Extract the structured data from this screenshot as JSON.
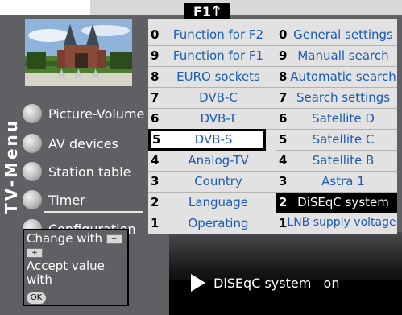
{
  "header": {
    "key_label": "F1",
    "arrow_icon": "up-arrow"
  },
  "rating_stars": "★★★",
  "sidebar": {
    "title": "TV-Menu",
    "items": [
      {
        "label": "Picture-Volume"
      },
      {
        "label": "AV devices"
      },
      {
        "label": "Station table"
      },
      {
        "label": "Timer"
      },
      {
        "label": "Configuration"
      }
    ]
  },
  "middle_menu": [
    {
      "num": "0",
      "label": "Function for F2"
    },
    {
      "num": "9",
      "label": "Function for F1"
    },
    {
      "num": "8",
      "label": "EURO sockets"
    },
    {
      "num": "7",
      "label": "DVB-C"
    },
    {
      "num": "6",
      "label": "DVB-T"
    },
    {
      "num": "5",
      "label": "DVB-S"
    },
    {
      "num": "4",
      "label": "Analog-TV"
    },
    {
      "num": "3",
      "label": "Country"
    },
    {
      "num": "2",
      "label": "Language"
    },
    {
      "num": "1",
      "label": "Operating"
    }
  ],
  "right_menu": [
    {
      "num": "0",
      "label": "General settings"
    },
    {
      "num": "9",
      "label": "Manuall search"
    },
    {
      "num": "8",
      "label": "Automatic search"
    },
    {
      "num": "7",
      "label": "Search settings"
    },
    {
      "num": "6",
      "label": "Satellite D"
    },
    {
      "num": "5",
      "label": "Satellite C"
    },
    {
      "num": "4",
      "label": "Satellite B"
    },
    {
      "num": "3",
      "label": "Astra 1"
    },
    {
      "num": "2",
      "label": "DiSEqC system"
    },
    {
      "num": "1",
      "label": "LNB supply voltage"
    }
  ],
  "help": {
    "line1": "Change with",
    "minus": "−",
    "plus": "+",
    "line2": "Accept value with",
    "ok": "OK"
  },
  "status": {
    "text": "DiSEqC system   on"
  }
}
